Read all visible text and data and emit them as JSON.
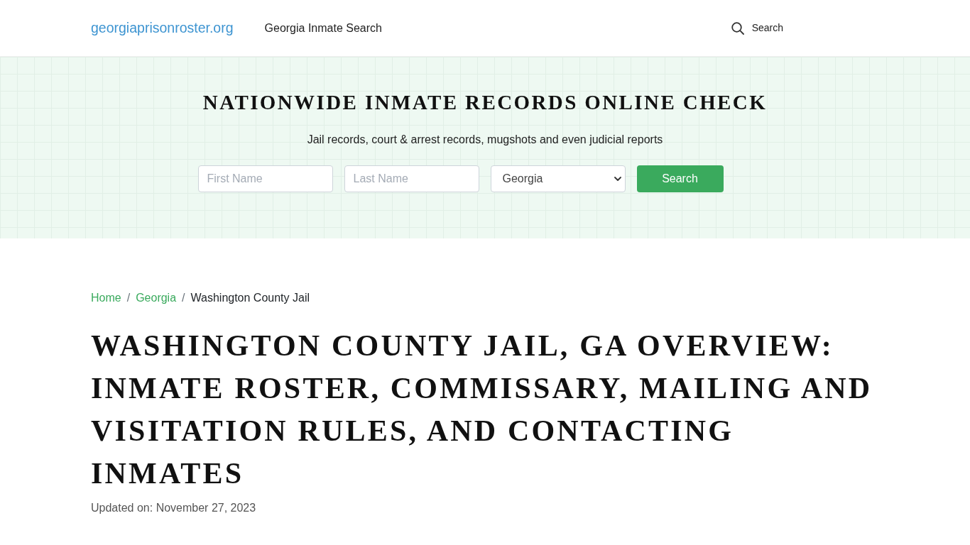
{
  "header": {
    "logo": "georgiaprisonroster.org",
    "nav": [
      {
        "label": "Georgia Inmate Search"
      }
    ],
    "search": {
      "label": "Search"
    }
  },
  "hero": {
    "title": "NATIONWIDE INMATE RECORDS ONLINE CHECK",
    "subtitle": "Jail records, court & arrest records, mugshots and even judicial reports",
    "form": {
      "first_name": {
        "placeholder": "First Name"
      },
      "last_name": {
        "placeholder": "Last Name"
      },
      "state": {
        "value": "Georgia"
      },
      "submit": "Search"
    }
  },
  "breadcrumb": [
    {
      "label": "Home",
      "kind": "link",
      "separator": "/"
    },
    {
      "label": "Georgia",
      "kind": "link",
      "separator": "/"
    },
    {
      "label": "Washington County Jail",
      "kind": "current"
    }
  ],
  "article": {
    "title": "WASHINGTON COUNTY JAIL, GA OVERVIEW: INMATE ROSTER, COMMISSARY, MAILING AND VISITATION RULES, AND CONTACTING INMATES",
    "updated": "Updated on: November 27, 2023"
  }
}
